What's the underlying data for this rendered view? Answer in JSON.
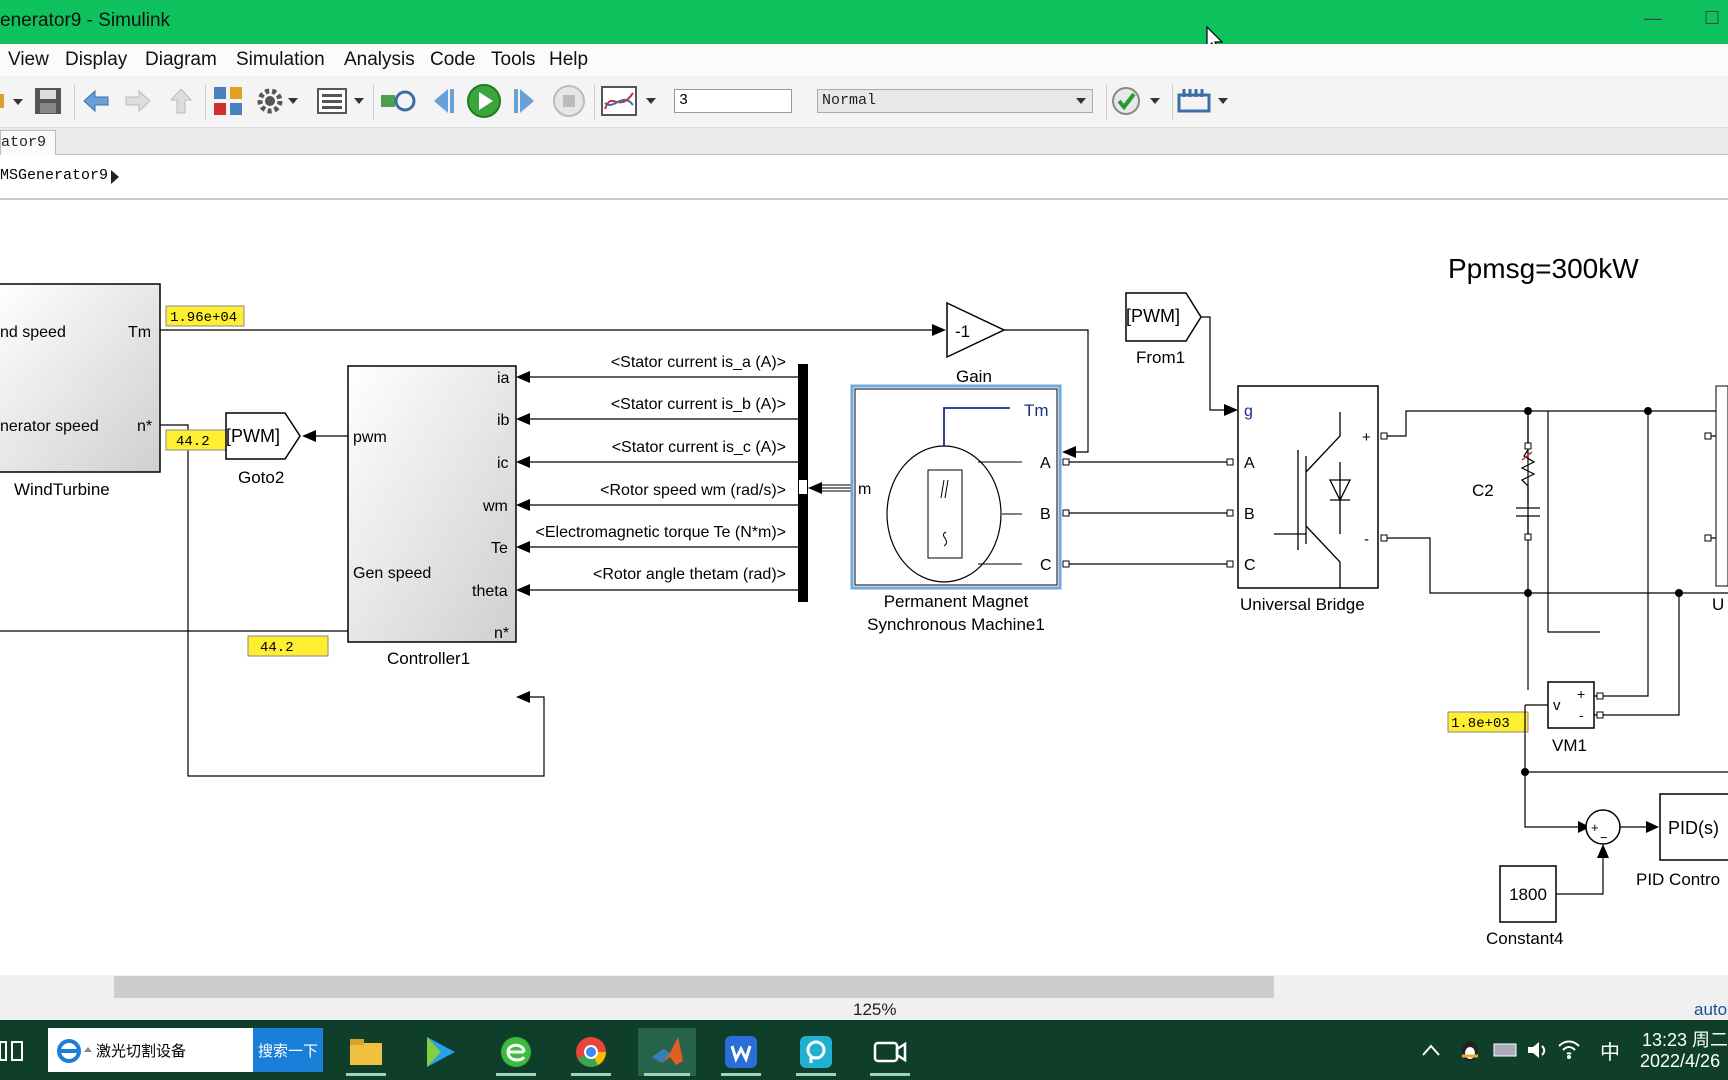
{
  "window": {
    "title": "enerator9 - Simulink",
    "minimize": "—",
    "maximize": "☐"
  },
  "menu": [
    "View",
    "Display",
    "Diagram",
    "Simulation",
    "Analysis",
    "Code",
    "Tools",
    "Help"
  ],
  "toolbar": {
    "stop_time": "3",
    "sim_mode": "Normal"
  },
  "tab": {
    "label": "ator9"
  },
  "breadcrumb": {
    "path": "MSGenerator9"
  },
  "diagram": {
    "annotation": "Ppmsg=300kW",
    "blocks": {
      "wind_turbine": {
        "name": "WindTurbine",
        "port_wind": "nd speed",
        "port_gen": "nerator speed",
        "port_tm": "Tm",
        "port_n": "n*"
      },
      "controller": {
        "name": "Controller1",
        "out_pwm": "pwm",
        "in_gen_speed": "Gen speed",
        "ports": [
          "ia",
          "ib",
          "ic",
          "wm",
          "Te",
          "theta",
          "n*"
        ]
      },
      "goto": {
        "name": "Goto2",
        "tag": "[PWM]"
      },
      "gain": {
        "name": "Gain",
        "value": "-1"
      },
      "from": {
        "name": "From1",
        "tag": "[PWM]"
      },
      "pmsm": {
        "name_line1": "Permanent Magnet",
        "name_line2": "Synchronous Machine1",
        "port_tm": "Tm",
        "port_m": "m",
        "ports": [
          "A",
          "B",
          "C"
        ]
      },
      "bridge": {
        "name": "Universal Bridge",
        "port_g": "g",
        "ports": [
          "A",
          "B",
          "C"
        ],
        "plus": "+",
        "minus": "-"
      },
      "capacitor": {
        "name": "C2"
      },
      "vm": {
        "name": "VM1",
        "v": "v",
        "plus": "+",
        "minus": "-"
      },
      "pid": {
        "name": "PID Contro",
        "label": "PID(s)"
      },
      "constant": {
        "name": "Constant4",
        "value": "1800"
      },
      "sum": {
        "plus": "+",
        "minus": "−"
      }
    },
    "bus_signals": [
      "<Stator current is_a (A)>",
      "<Stator current is_b (A)>",
      "<Stator current is_c (A)>",
      "<Rotor speed wm (rad/s)>",
      "<Electromagnetic torque Te (N*m)>",
      "<Rotor angle thetam (rad)>"
    ],
    "displays": {
      "tm": "1.96e+04",
      "n1": "44.2",
      "n2": "44.2",
      "vm": "1.8e+03"
    },
    "cut_label": "U"
  },
  "status": {
    "zoom": "125%",
    "solver": "auto"
  },
  "taskbar": {
    "search_text": "激光切割设备",
    "search_button": "搜索一下",
    "ime": "中",
    "time": "13:23 周二",
    "date": "2022/4/26"
  },
  "colors": {
    "titlebar": "#0ec25e",
    "taskbar": "#0f3f2a",
    "display_bg": "#ffef33",
    "selection": "#6fa8dc"
  }
}
